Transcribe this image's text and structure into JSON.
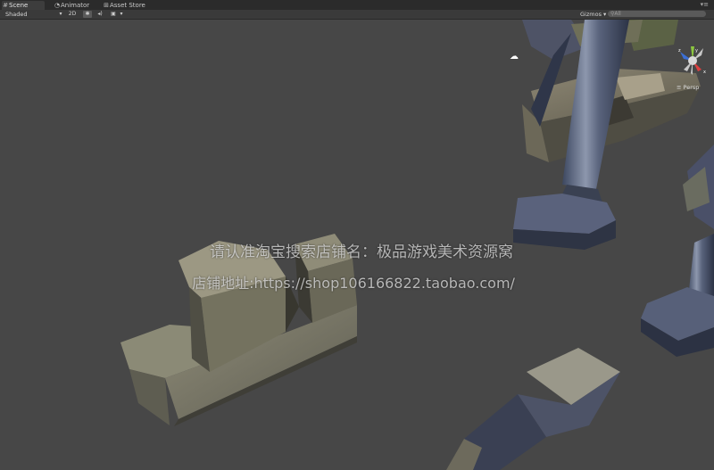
{
  "tabs": [
    {
      "label": "Scene",
      "icon": "scene-icon",
      "active": true
    },
    {
      "label": "Animator",
      "icon": "animator-icon",
      "active": false
    },
    {
      "label": "Asset Store",
      "icon": "store-icon",
      "active": false
    }
  ],
  "toolbar": {
    "shading_mode": "Shaded",
    "mode_2d": "2D",
    "gizmos_label": "Gizmos",
    "search_placeholder": "All"
  },
  "scene": {
    "projection_label": "Persp"
  },
  "watermark": {
    "line1": "请认准淘宝搜索店铺名：极品游戏美术资源窝",
    "line2": "店铺地址:https://shop106166822.taobao.com/"
  }
}
